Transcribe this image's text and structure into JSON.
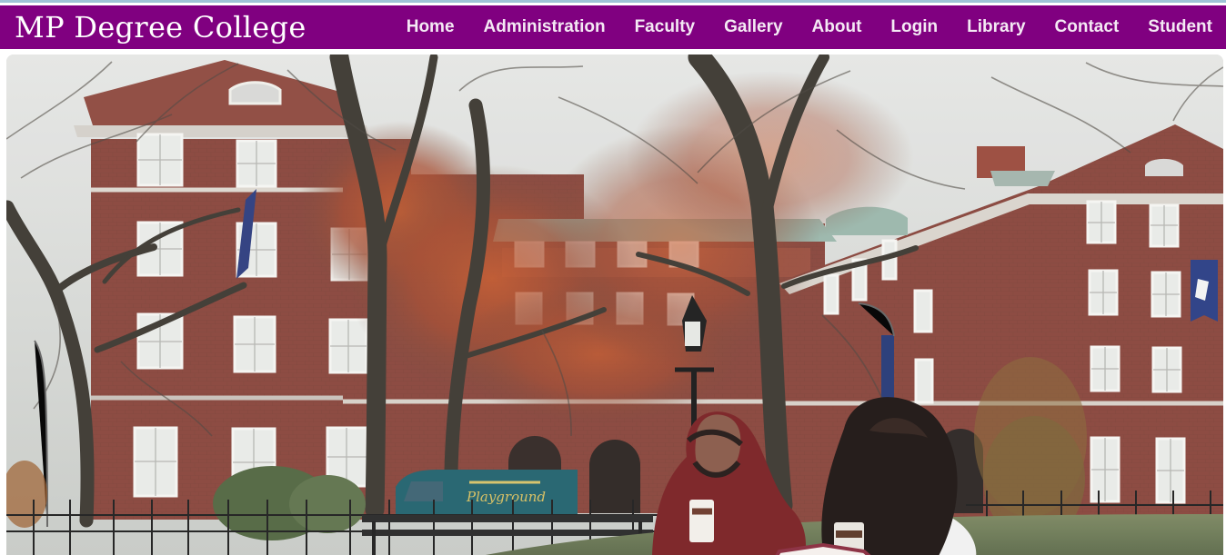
{
  "brand": {
    "title": "MP Degree College"
  },
  "nav": {
    "items": [
      {
        "label": "Home"
      },
      {
        "label": "Administration"
      },
      {
        "label": "Faculty"
      },
      {
        "label": "Gallery"
      },
      {
        "label": "About"
      },
      {
        "label": "Login"
      },
      {
        "label": "Library"
      },
      {
        "label": "Contact"
      },
      {
        "label": "Student"
      }
    ]
  },
  "hero": {
    "van_text": "Playground"
  },
  "colors": {
    "navbar": "#800080",
    "brick": "#8e4a40",
    "sky": "#d8d9d6",
    "grass": "#6f7d56"
  }
}
